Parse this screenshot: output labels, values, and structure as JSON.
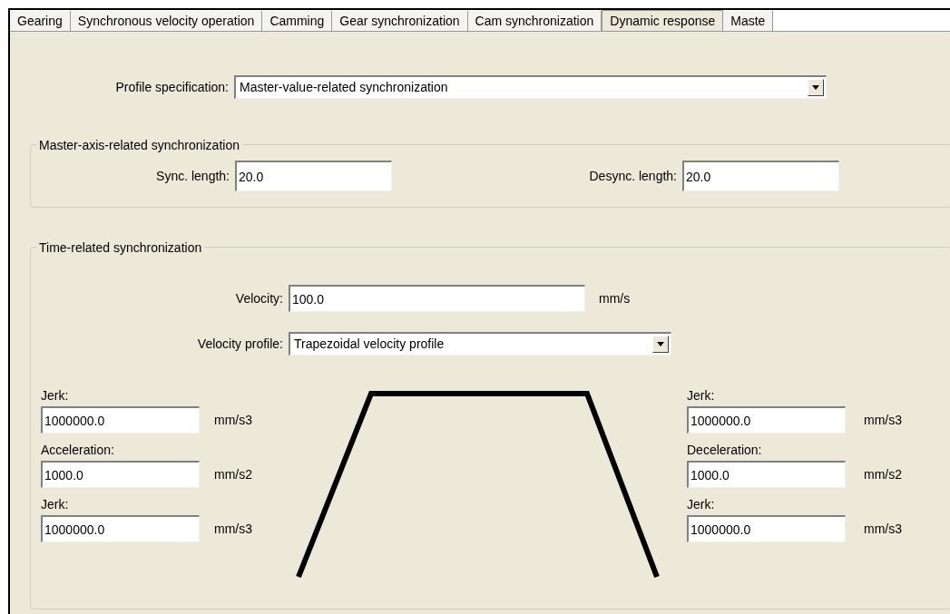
{
  "tabs": [
    {
      "label": "Gearing",
      "selected": false
    },
    {
      "label": "Synchronous velocity operation",
      "selected": false
    },
    {
      "label": "Camming",
      "selected": false
    },
    {
      "label": "Gear synchronization",
      "selected": false
    },
    {
      "label": "Cam synchronization",
      "selected": false
    },
    {
      "label": "Dynamic response",
      "selected": true
    },
    {
      "label": "Maste",
      "selected": false
    }
  ],
  "profile_specification": {
    "label": "Profile specification:",
    "value": "Master-value-related synchronization"
  },
  "master_axis_group": {
    "title": "Master-axis-related synchronization",
    "sync_length": {
      "label": "Sync. length:",
      "value": "20.0"
    },
    "desync_length": {
      "label": "Desync. length:",
      "value": "20.0"
    }
  },
  "time_group": {
    "title": "Time-related synchronization",
    "velocity": {
      "label": "Velocity:",
      "value": "100.0",
      "unit": "mm/s"
    },
    "velocity_profile": {
      "label": "Velocity profile:",
      "value": "Trapezoidal velocity profile"
    },
    "left_fields": [
      {
        "label": "Jerk:",
        "value": "1000000.0",
        "unit": "mm/s3"
      },
      {
        "label": "Acceleration:",
        "value": "1000.0",
        "unit": "mm/s2"
      },
      {
        "label": "Jerk:",
        "value": "1000000.0",
        "unit": "mm/s3"
      }
    ],
    "right_fields": [
      {
        "label": "Jerk:",
        "value": "1000000.0",
        "unit": "mm/s3"
      },
      {
        "label": "Deceleration:",
        "value": "1000.0",
        "unit": "mm/s2"
      },
      {
        "label": "Jerk:",
        "value": "1000000.0",
        "unit": "mm/s3"
      }
    ]
  }
}
